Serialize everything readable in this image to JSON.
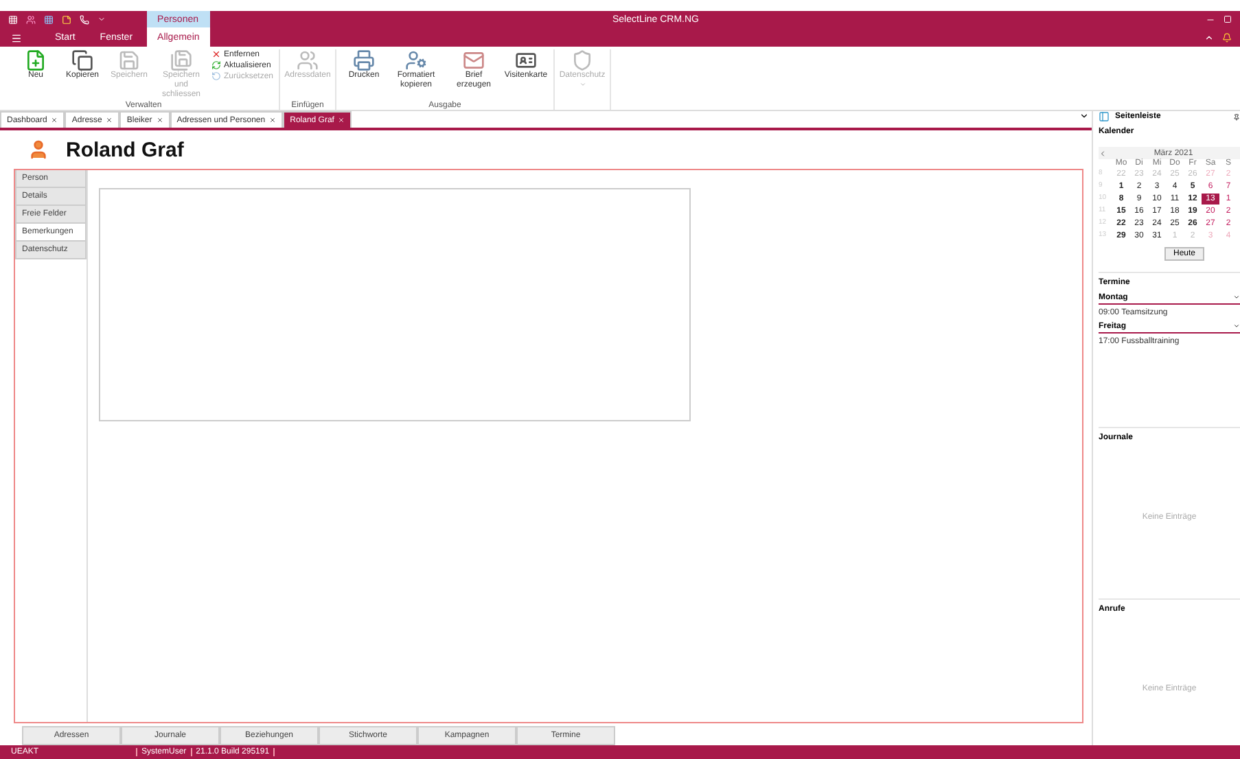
{
  "window": {
    "title": "SelectLine CRM.NG"
  },
  "ribbon_tabs": [
    {
      "label": "Start",
      "selected": false
    },
    {
      "label": "Fenster",
      "selected": false
    },
    {
      "label": "Allgemein",
      "selected": true,
      "context": "Personen"
    }
  ],
  "ribbon_groups": [
    {
      "label": "Verwalten",
      "buttons": [
        {
          "label": "Neu",
          "kind": "large",
          "disabled": false
        },
        {
          "label": "Kopieren",
          "kind": "large",
          "disabled": false
        },
        {
          "label": "Speichern",
          "kind": "large",
          "disabled": true
        },
        {
          "label": "Speichern und schliessen",
          "kind": "large",
          "disabled": true
        },
        {
          "label": "Entfernen",
          "kind": "small",
          "disabled": false
        },
        {
          "label": "Aktualisieren",
          "kind": "small",
          "disabled": false
        },
        {
          "label": "Zurücksetzen",
          "kind": "small",
          "disabled": true
        }
      ]
    },
    {
      "label": "Einfügen",
      "buttons": [
        {
          "label": "Adressdaten",
          "kind": "large",
          "disabled": true
        }
      ]
    },
    {
      "label": "Ausgabe",
      "buttons": [
        {
          "label": "Drucken",
          "kind": "large",
          "disabled": false
        },
        {
          "label": "Formatiert kopieren",
          "kind": "large",
          "disabled": false
        },
        {
          "label": "Brief erzeugen",
          "kind": "large",
          "disabled": false
        },
        {
          "label": "Visitenkarte",
          "kind": "large",
          "disabled": false
        }
      ]
    },
    {
      "buttons": [
        {
          "label": "Datenschutz",
          "kind": "dropdown",
          "disabled": true
        }
      ]
    }
  ],
  "doc_tabs": [
    {
      "label": "Dashboard",
      "selected": false
    },
    {
      "label": "Adresse",
      "selected": false
    },
    {
      "label": "Bleiker",
      "selected": false
    },
    {
      "label": "Adressen und Personen",
      "selected": false
    },
    {
      "label": "Roland Graf",
      "selected": true
    }
  ],
  "record": {
    "title": "Roland Graf"
  },
  "side_tabs": [
    {
      "label": "Person",
      "selected": false
    },
    {
      "label": "Details",
      "selected": false
    },
    {
      "label": "Freie Felder",
      "selected": false
    },
    {
      "label": "Bemerkungen",
      "selected": true
    },
    {
      "label": "Datenschutz",
      "selected": false
    }
  ],
  "bottom_tabs": [
    {
      "label": "Adressen",
      "selected": false
    },
    {
      "label": "Journale",
      "selected": false
    },
    {
      "label": "Beziehungen",
      "selected": false
    },
    {
      "label": "Stichworte",
      "selected": false
    },
    {
      "label": "Kampagnen",
      "selected": false
    },
    {
      "label": "Termine",
      "selected": false
    }
  ],
  "status_bar": [
    "UEAKT",
    "SystemUser",
    "21.1.0 Build 295191"
  ],
  "sidebar": {
    "title": "Seitenleiste",
    "calendar": {
      "heading": "Kalender",
      "month": "März 2021",
      "weekdays": [
        "Mo",
        "Di",
        "Mi",
        "Do",
        "Fr",
        "Sa",
        "S"
      ],
      "weeks": [
        {
          "week": "8",
          "days": [
            {
              "d": "22",
              "muted": true,
              "bold": false,
              "selected": false
            },
            {
              "d": "23",
              "muted": true,
              "bold": false,
              "selected": false
            },
            {
              "d": "24",
              "muted": true,
              "bold": false,
              "selected": false
            },
            {
              "d": "25",
              "muted": true,
              "bold": false,
              "selected": false
            },
            {
              "d": "26",
              "muted": true,
              "bold": false,
              "selected": false
            },
            {
              "d": "27",
              "muted": true,
              "bold": false,
              "selected": false
            },
            {
              "d": "2",
              "muted": true,
              "bold": false,
              "selected": false
            }
          ]
        },
        {
          "week": "9",
          "days": [
            {
              "d": "1",
              "muted": false,
              "bold": true,
              "selected": false
            },
            {
              "d": "2",
              "muted": false,
              "bold": false,
              "selected": false
            },
            {
              "d": "3",
              "muted": false,
              "bold": false,
              "selected": false
            },
            {
              "d": "4",
              "muted": false,
              "bold": false,
              "selected": false
            },
            {
              "d": "5",
              "muted": false,
              "bold": true,
              "selected": false
            },
            {
              "d": "6",
              "muted": false,
              "bold": false,
              "selected": false
            },
            {
              "d": "7",
              "muted": false,
              "bold": false,
              "selected": false
            }
          ]
        },
        {
          "week": "10",
          "days": [
            {
              "d": "8",
              "muted": false,
              "bold": true,
              "selected": false
            },
            {
              "d": "9",
              "muted": false,
              "bold": false,
              "selected": false
            },
            {
              "d": "10",
              "muted": false,
              "bold": false,
              "selected": false
            },
            {
              "d": "11",
              "muted": false,
              "bold": false,
              "selected": false
            },
            {
              "d": "12",
              "muted": false,
              "bold": true,
              "selected": false
            },
            {
              "d": "13",
              "muted": false,
              "bold": false,
              "selected": true
            },
            {
              "d": "1",
              "muted": false,
              "bold": false,
              "selected": false
            }
          ]
        },
        {
          "week": "11",
          "days": [
            {
              "d": "15",
              "muted": false,
              "bold": true,
              "selected": false
            },
            {
              "d": "16",
              "muted": false,
              "bold": false,
              "selected": false
            },
            {
              "d": "17",
              "muted": false,
              "bold": false,
              "selected": false
            },
            {
              "d": "18",
              "muted": false,
              "bold": false,
              "selected": false
            },
            {
              "d": "19",
              "muted": false,
              "bold": true,
              "selected": false
            },
            {
              "d": "20",
              "muted": false,
              "bold": false,
              "selected": false
            },
            {
              "d": "2",
              "muted": false,
              "bold": false,
              "selected": false
            }
          ]
        },
        {
          "week": "12",
          "days": [
            {
              "d": "22",
              "muted": false,
              "bold": true,
              "selected": false
            },
            {
              "d": "23",
              "muted": false,
              "bold": false,
              "selected": false
            },
            {
              "d": "24",
              "muted": false,
              "bold": false,
              "selected": false
            },
            {
              "d": "25",
              "muted": false,
              "bold": false,
              "selected": false
            },
            {
              "d": "26",
              "muted": false,
              "bold": true,
              "selected": false
            },
            {
              "d": "27",
              "muted": false,
              "bold": false,
              "selected": false
            },
            {
              "d": "2",
              "muted": false,
              "bold": false,
              "selected": false
            }
          ]
        },
        {
          "week": "13",
          "days": [
            {
              "d": "29",
              "muted": false,
              "bold": true,
              "selected": false
            },
            {
              "d": "30",
              "muted": false,
              "bold": false,
              "selected": false
            },
            {
              "d": "31",
              "muted": false,
              "bold": false,
              "selected": false
            },
            {
              "d": "1",
              "muted": true,
              "bold": false,
              "selected": false
            },
            {
              "d": "2",
              "muted": true,
              "bold": false,
              "selected": false
            },
            {
              "d": "3",
              "muted": true,
              "bold": false,
              "selected": false
            },
            {
              "d": "4",
              "muted": true,
              "bold": false,
              "selected": false
            }
          ]
        }
      ],
      "today_button": "Heute"
    },
    "appointments": {
      "heading": "Termine",
      "groups": [
        {
          "day": "Montag",
          "items": [
            "09:00 Teamsitzung"
          ]
        },
        {
          "day": "Freitag",
          "items": [
            "17:00 Fussballtraining"
          ]
        }
      ]
    },
    "journals": {
      "heading": "Journale",
      "empty": "Keine Einträge"
    },
    "calls": {
      "heading": "Anrufe",
      "empty": "Keine Einträge"
    }
  }
}
